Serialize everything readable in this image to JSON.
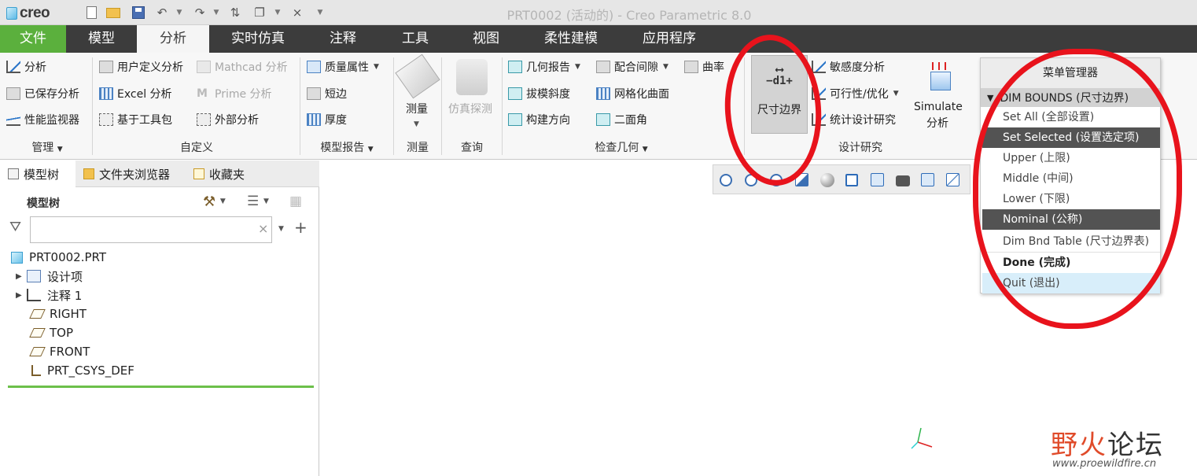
{
  "titlebar": {
    "logo_text": "creo",
    "title": "PRT0002 (活动的) - Creo Parametric 8.0",
    "quick_access": [
      "new-icon",
      "open-icon",
      "save-icon",
      "undo-icon",
      "redo-icon",
      "regenerate-icon",
      "windows-icon",
      "close-icon",
      "customize-icon"
    ]
  },
  "tabs": [
    "文件",
    "模型",
    "分析",
    "实时仿真",
    "注释",
    "工具",
    "视图",
    "柔性建模",
    "应用程序"
  ],
  "ribbon": {
    "manage": {
      "items": [
        "分析",
        "已保存分析",
        "性能监视器"
      ],
      "label": "管理"
    },
    "custom": {
      "items": [
        "用户定义分析",
        "Excel 分析",
        "基于工具包",
        "Mathcad 分析",
        "Prime 分析",
        "外部分析"
      ],
      "label": "自定义"
    },
    "model_report": {
      "items": [
        "质量属性",
        "短边",
        "厚度"
      ],
      "label": "模型报告"
    },
    "measure": {
      "button": "测量",
      "label": "测量"
    },
    "query": {
      "button": "仿真探测",
      "label": "查询"
    },
    "inspect": {
      "items": [
        "几何报告",
        "拔模斜度",
        "构建方向",
        "配合间隙",
        "网格化曲面",
        "二面角",
        "曲率"
      ],
      "label": "检查几何"
    },
    "design_study": {
      "dim_bounds_button": "尺寸边界",
      "dim_glyph_top": "⟷",
      "dim_glyph": "−d1+",
      "items": [
        "敏感度分析",
        "可行性/优化",
        "统计设计研究"
      ],
      "simulate_line1": "Simulate",
      "simulate_line2": "分析",
      "label": "设计研究"
    }
  },
  "left_panel": {
    "tabs": [
      "模型树",
      "文件夹浏览器",
      "收藏夹"
    ],
    "header": "模型树",
    "search": {
      "value": "",
      "placeholder": ""
    },
    "tree": [
      {
        "label": "PRT0002.PRT",
        "icon": "part-icon",
        "expandable": false
      },
      {
        "label": "设计项",
        "icon": "design-items-icon",
        "expandable": true
      },
      {
        "label": "注释 1",
        "icon": "annotation-icon",
        "expandable": true
      },
      {
        "label": "RIGHT",
        "icon": "datum-plane-icon",
        "expandable": false
      },
      {
        "label": "TOP",
        "icon": "datum-plane-icon",
        "expandable": false
      },
      {
        "label": "FRONT",
        "icon": "datum-plane-icon",
        "expandable": false
      },
      {
        "label": "PRT_CSYS_DEF",
        "icon": "csys-icon",
        "expandable": false
      }
    ]
  },
  "menu_manager": {
    "title": "菜单管理器",
    "section": "DIM BOUNDS (尺寸边界)",
    "items": [
      {
        "label": "Set All (全部设置)",
        "state": "normal"
      },
      {
        "label": "Set Selected (设置选定项)",
        "state": "selected"
      },
      {
        "label": "Upper (上限)",
        "state": "normal"
      },
      {
        "label": "Middle (中间)",
        "state": "normal"
      },
      {
        "label": "Lower (下限)",
        "state": "normal"
      },
      {
        "label": "Nominal (公称)",
        "state": "selected"
      },
      {
        "label": "Dim Bnd Table (尺寸边界表)",
        "state": "normal"
      },
      {
        "label": "Done (完成)",
        "state": "bold"
      },
      {
        "label": "Quit (退出)",
        "state": "hover"
      }
    ]
  },
  "watermark": {
    "line1_a": "野火",
    "line1_b": "论坛",
    "line2": "www.proewildfire.cn"
  },
  "colors": {
    "file_tab": "#5bb03d",
    "tab_bar": "#3c3c3c",
    "menu_selected": "#535353",
    "menu_hover": "#d8eefa",
    "annotation_ring": "#e8131c",
    "tree_underline": "#6cc04a"
  }
}
